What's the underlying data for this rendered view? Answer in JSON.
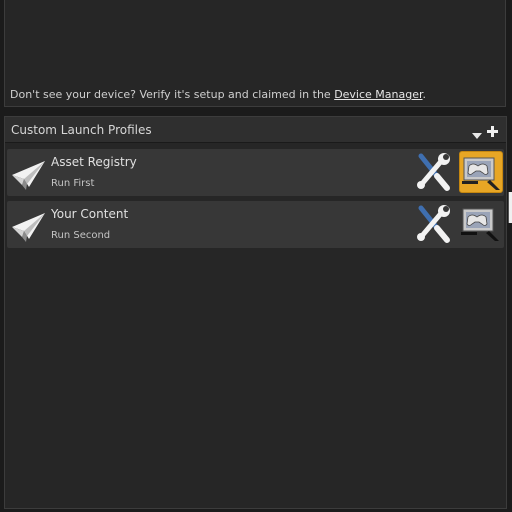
{
  "device_panel": {
    "message": "Don't see your device? Verify it's setup and claimed in the",
    "link_label": "Device Manager",
    "trailing": "."
  },
  "profiles": {
    "title": "Custom Launch Profiles",
    "items": [
      {
        "name": "Asset Registry",
        "subtitle": "Run First",
        "launch_active": true
      },
      {
        "name": "Your Content",
        "subtitle": "Run Second",
        "launch_active": false
      }
    ]
  },
  "colors": {
    "accent": "#e7a625",
    "panel_bg": "#262626",
    "row_bg": "#373737"
  },
  "icons": {
    "profile": "paper-plane-icon",
    "edit": "wrench-screwdriver-icon",
    "launch": "gamepad-monitor-icon",
    "dropdown": "chevron-down-icon",
    "add": "plus-icon"
  }
}
